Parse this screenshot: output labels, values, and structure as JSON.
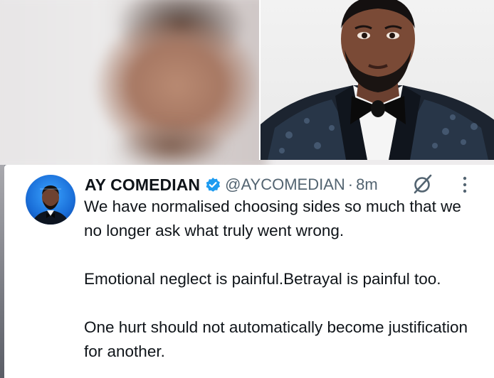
{
  "tweet": {
    "display_name": "AY COMEDIAN",
    "verified_icon": "verified-badge-icon",
    "handle": "@AYCOMEDIAN",
    "separator": "·",
    "time": "8m",
    "grok_icon": "grok-icon",
    "more_icon": "more-options-icon",
    "paragraphs": [
      "We have normalised choosing sides so much that we no longer ask what truly went wrong.",
      "Emotional neglect is painful.Betrayal is painful too.",
      "One hurt should not automatically become justification for another."
    ]
  },
  "colors": {
    "verified": "#1d9bf0",
    "text": "#0f1419",
    "muted": "#536471"
  }
}
